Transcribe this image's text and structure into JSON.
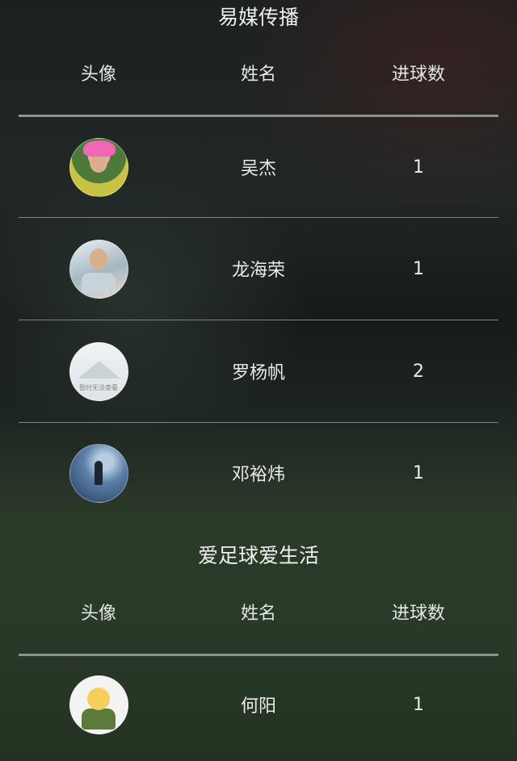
{
  "columns": {
    "avatar": "头像",
    "name": "姓名",
    "goals": "进球数"
  },
  "teams": [
    {
      "name": "易媒传播",
      "players": [
        {
          "name": "吴杰",
          "goals": "1",
          "avatar_icon": "photo-avatar-pink-hat-icon"
        },
        {
          "name": "龙海荣",
          "goals": "1",
          "avatar_icon": "photo-avatar-person-sitting-icon"
        },
        {
          "name": "罗杨帆",
          "goals": "2",
          "avatar_icon": "placeholder-avatar-mountain-icon",
          "avatar_text": "暂时无法查看"
        },
        {
          "name": "邓裕炜",
          "goals": "1",
          "avatar_icon": "photo-avatar-silhouette-icon"
        }
      ]
    },
    {
      "name": "爱足球爱生活",
      "players": [
        {
          "name": "何阳",
          "goals": "1",
          "avatar_icon": "cartoon-avatar-soldier-icon"
        }
      ]
    }
  ]
}
